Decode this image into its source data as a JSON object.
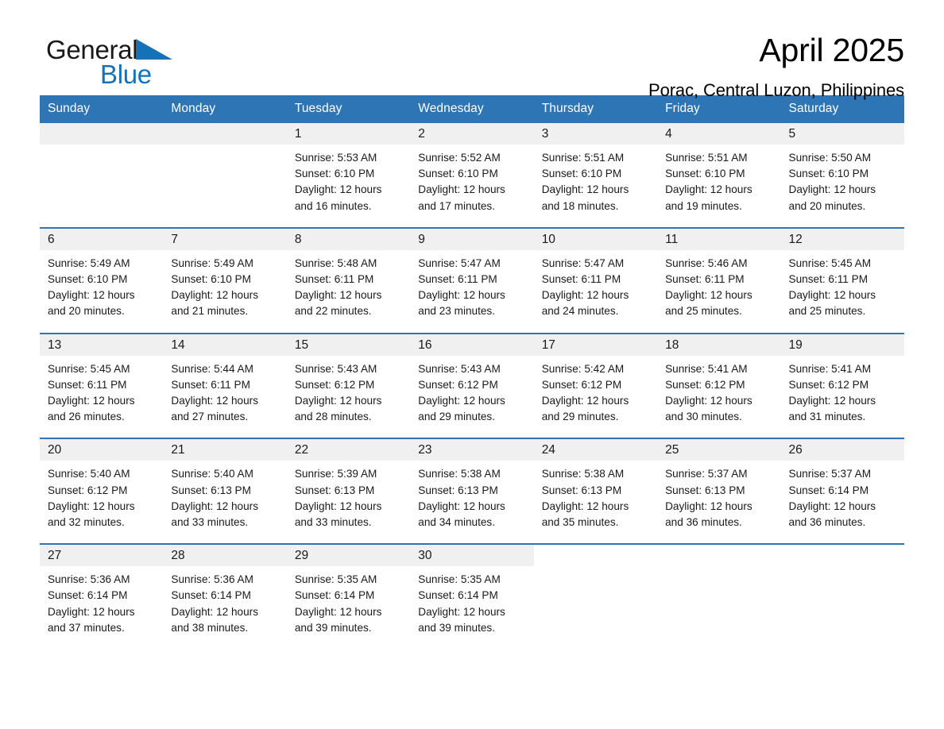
{
  "brand": {
    "name_top": "General",
    "name_bottom": "Blue",
    "triangle_color": "#1672b8",
    "text_color": "#1a1a1a"
  },
  "header": {
    "title": "April 2025",
    "subtitle": "Porac, Central Luzon, Philippines"
  },
  "theme": {
    "header_blue": "#2e75b6",
    "daynum_band": "#f0f0f0",
    "text": "#1a1a1a"
  },
  "weekday_headers": [
    "Sunday",
    "Monday",
    "Tuesday",
    "Wednesday",
    "Thursday",
    "Friday",
    "Saturday"
  ],
  "calendar": {
    "month": "April",
    "year": 2025,
    "weeks": [
      [
        {
          "day": null
        },
        {
          "day": null
        },
        {
          "day": "1",
          "sunrise": "Sunrise: 5:53 AM",
          "sunset": "Sunset: 6:10 PM",
          "daylight_1": "Daylight: 12 hours",
          "daylight_2": "and 16 minutes."
        },
        {
          "day": "2",
          "sunrise": "Sunrise: 5:52 AM",
          "sunset": "Sunset: 6:10 PM",
          "daylight_1": "Daylight: 12 hours",
          "daylight_2": "and 17 minutes."
        },
        {
          "day": "3",
          "sunrise": "Sunrise: 5:51 AM",
          "sunset": "Sunset: 6:10 PM",
          "daylight_1": "Daylight: 12 hours",
          "daylight_2": "and 18 minutes."
        },
        {
          "day": "4",
          "sunrise": "Sunrise: 5:51 AM",
          "sunset": "Sunset: 6:10 PM",
          "daylight_1": "Daylight: 12 hours",
          "daylight_2": "and 19 minutes."
        },
        {
          "day": "5",
          "sunrise": "Sunrise: 5:50 AM",
          "sunset": "Sunset: 6:10 PM",
          "daylight_1": "Daylight: 12 hours",
          "daylight_2": "and 20 minutes."
        }
      ],
      [
        {
          "day": "6",
          "sunrise": "Sunrise: 5:49 AM",
          "sunset": "Sunset: 6:10 PM",
          "daylight_1": "Daylight: 12 hours",
          "daylight_2": "and 20 minutes."
        },
        {
          "day": "7",
          "sunrise": "Sunrise: 5:49 AM",
          "sunset": "Sunset: 6:10 PM",
          "daylight_1": "Daylight: 12 hours",
          "daylight_2": "and 21 minutes."
        },
        {
          "day": "8",
          "sunrise": "Sunrise: 5:48 AM",
          "sunset": "Sunset: 6:11 PM",
          "daylight_1": "Daylight: 12 hours",
          "daylight_2": "and 22 minutes."
        },
        {
          "day": "9",
          "sunrise": "Sunrise: 5:47 AM",
          "sunset": "Sunset: 6:11 PM",
          "daylight_1": "Daylight: 12 hours",
          "daylight_2": "and 23 minutes."
        },
        {
          "day": "10",
          "sunrise": "Sunrise: 5:47 AM",
          "sunset": "Sunset: 6:11 PM",
          "daylight_1": "Daylight: 12 hours",
          "daylight_2": "and 24 minutes."
        },
        {
          "day": "11",
          "sunrise": "Sunrise: 5:46 AM",
          "sunset": "Sunset: 6:11 PM",
          "daylight_1": "Daylight: 12 hours",
          "daylight_2": "and 25 minutes."
        },
        {
          "day": "12",
          "sunrise": "Sunrise: 5:45 AM",
          "sunset": "Sunset: 6:11 PM",
          "daylight_1": "Daylight: 12 hours",
          "daylight_2": "and 25 minutes."
        }
      ],
      [
        {
          "day": "13",
          "sunrise": "Sunrise: 5:45 AM",
          "sunset": "Sunset: 6:11 PM",
          "daylight_1": "Daylight: 12 hours",
          "daylight_2": "and 26 minutes."
        },
        {
          "day": "14",
          "sunrise": "Sunrise: 5:44 AM",
          "sunset": "Sunset: 6:11 PM",
          "daylight_1": "Daylight: 12 hours",
          "daylight_2": "and 27 minutes."
        },
        {
          "day": "15",
          "sunrise": "Sunrise: 5:43 AM",
          "sunset": "Sunset: 6:12 PM",
          "daylight_1": "Daylight: 12 hours",
          "daylight_2": "and 28 minutes."
        },
        {
          "day": "16",
          "sunrise": "Sunrise: 5:43 AM",
          "sunset": "Sunset: 6:12 PM",
          "daylight_1": "Daylight: 12 hours",
          "daylight_2": "and 29 minutes."
        },
        {
          "day": "17",
          "sunrise": "Sunrise: 5:42 AM",
          "sunset": "Sunset: 6:12 PM",
          "daylight_1": "Daylight: 12 hours",
          "daylight_2": "and 29 minutes."
        },
        {
          "day": "18",
          "sunrise": "Sunrise: 5:41 AM",
          "sunset": "Sunset: 6:12 PM",
          "daylight_1": "Daylight: 12 hours",
          "daylight_2": "and 30 minutes."
        },
        {
          "day": "19",
          "sunrise": "Sunrise: 5:41 AM",
          "sunset": "Sunset: 6:12 PM",
          "daylight_1": "Daylight: 12 hours",
          "daylight_2": "and 31 minutes."
        }
      ],
      [
        {
          "day": "20",
          "sunrise": "Sunrise: 5:40 AM",
          "sunset": "Sunset: 6:12 PM",
          "daylight_1": "Daylight: 12 hours",
          "daylight_2": "and 32 minutes."
        },
        {
          "day": "21",
          "sunrise": "Sunrise: 5:40 AM",
          "sunset": "Sunset: 6:13 PM",
          "daylight_1": "Daylight: 12 hours",
          "daylight_2": "and 33 minutes."
        },
        {
          "day": "22",
          "sunrise": "Sunrise: 5:39 AM",
          "sunset": "Sunset: 6:13 PM",
          "daylight_1": "Daylight: 12 hours",
          "daylight_2": "and 33 minutes."
        },
        {
          "day": "23",
          "sunrise": "Sunrise: 5:38 AM",
          "sunset": "Sunset: 6:13 PM",
          "daylight_1": "Daylight: 12 hours",
          "daylight_2": "and 34 minutes."
        },
        {
          "day": "24",
          "sunrise": "Sunrise: 5:38 AM",
          "sunset": "Sunset: 6:13 PM",
          "daylight_1": "Daylight: 12 hours",
          "daylight_2": "and 35 minutes."
        },
        {
          "day": "25",
          "sunrise": "Sunrise: 5:37 AM",
          "sunset": "Sunset: 6:13 PM",
          "daylight_1": "Daylight: 12 hours",
          "daylight_2": "and 36 minutes."
        },
        {
          "day": "26",
          "sunrise": "Sunrise: 5:37 AM",
          "sunset": "Sunset: 6:14 PM",
          "daylight_1": "Daylight: 12 hours",
          "daylight_2": "and 36 minutes."
        }
      ],
      [
        {
          "day": "27",
          "sunrise": "Sunrise: 5:36 AM",
          "sunset": "Sunset: 6:14 PM",
          "daylight_1": "Daylight: 12 hours",
          "daylight_2": "and 37 minutes."
        },
        {
          "day": "28",
          "sunrise": "Sunrise: 5:36 AM",
          "sunset": "Sunset: 6:14 PM",
          "daylight_1": "Daylight: 12 hours",
          "daylight_2": "and 38 minutes."
        },
        {
          "day": "29",
          "sunrise": "Sunrise: 5:35 AM",
          "sunset": "Sunset: 6:14 PM",
          "daylight_1": "Daylight: 12 hours",
          "daylight_2": "and 39 minutes."
        },
        {
          "day": "30",
          "sunrise": "Sunrise: 5:35 AM",
          "sunset": "Sunset: 6:14 PM",
          "daylight_1": "Daylight: 12 hours",
          "daylight_2": "and 39 minutes."
        },
        {
          "day": null
        },
        {
          "day": null
        },
        {
          "day": null
        }
      ]
    ]
  }
}
